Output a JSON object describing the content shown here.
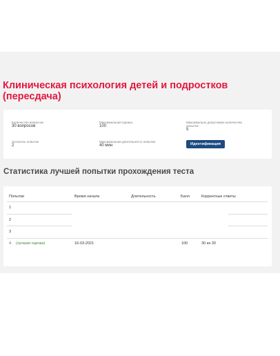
{
  "course": {
    "title": "Клиническая психология детей и подростков (пересдача)"
  },
  "info": {
    "question_count_label": "Количество вопросов",
    "question_count_value": "30 вопросов",
    "max_score_label": "Максимальная оценка",
    "max_score_value": "100",
    "max_attempts_label": "Максимально допустимое количество попыток",
    "max_attempts_value": "5",
    "attempts_left_label": "Осталось попыток",
    "attempts_left_value": "2",
    "max_duration_label": "Максимальная длительность попытки",
    "max_duration_value": "40 мин",
    "identification_button": "Идентификация"
  },
  "stats": {
    "title": "Статистика лучшей попытки прохождения теста",
    "columns": [
      "Попытки",
      "Время начала",
      "Длительность",
      "Балл",
      "Корректные ответы"
    ],
    "rows": [
      {
        "attempt": "1",
        "note": "",
        "start": "",
        "duration": "",
        "score": "",
        "correct": ""
      },
      {
        "attempt": "2",
        "note": "",
        "start": "",
        "duration": "",
        "score": "",
        "correct": ""
      },
      {
        "attempt": "3",
        "note": "",
        "start": "",
        "duration": "",
        "score": "",
        "correct": ""
      },
      {
        "attempt": "4",
        "note": "(лучшая оценка)",
        "start": "16-03-2021",
        "duration": "",
        "score": "100",
        "correct": "30 из 30"
      }
    ]
  },
  "colors": {
    "title_red": "#e3173e",
    "button_blue": "#1d4a80",
    "best_green": "#3a8a2f",
    "background_gray": "#f2f2f2"
  }
}
